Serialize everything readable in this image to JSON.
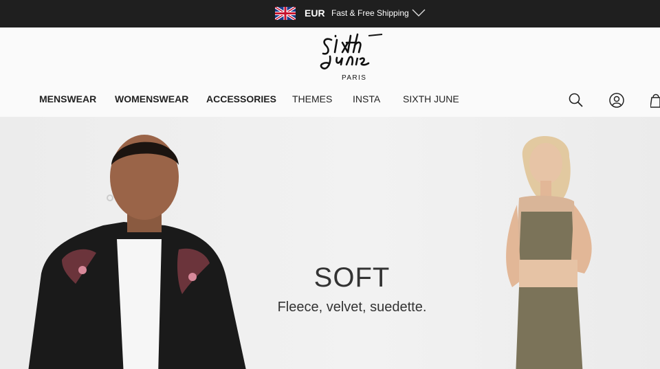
{
  "topbar": {
    "flag_icon": "uk-flag-icon",
    "currency": "EUR",
    "shipping": "Fast & Free Shipping",
    "chevron_icon": "chevron-down-icon"
  },
  "header": {
    "brand_sub": "PARIS",
    "nav": [
      {
        "label": "MENSWEAR",
        "bold": true
      },
      {
        "label": "WOMENSWEAR",
        "bold": true
      },
      {
        "label": "ACCESSORIES",
        "bold": true
      },
      {
        "label": "THEMES",
        "bold": false
      },
      {
        "label": "INSTA",
        "bold": false
      },
      {
        "label": "SIXTH JUNE",
        "bold": false
      }
    ],
    "icons": [
      "search-icon",
      "account-icon",
      "cart-icon"
    ]
  },
  "hero": {
    "title": "SOFT",
    "subtitle": "Fleece, velvet, suedette."
  },
  "colors": {
    "topbar_bg": "#1f1f1f",
    "header_bg": "#fafafa",
    "hero_bg": "#efefef",
    "text": "#222222"
  }
}
